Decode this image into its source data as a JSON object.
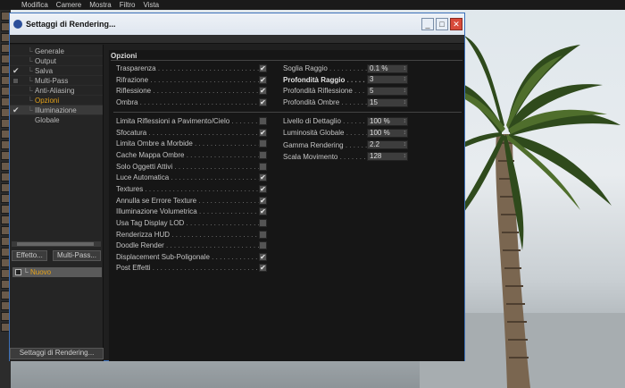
{
  "app_menu": [
    "Modifica",
    "Camere",
    "Mostra",
    "Filtro",
    "Vista"
  ],
  "window": {
    "title": "Settaggi di Rendering...",
    "buttons": {
      "minimize": "_",
      "maximize": "□",
      "close": "✕"
    }
  },
  "sidebar": {
    "items": [
      {
        "label": "Generale",
        "state": "none"
      },
      {
        "label": "Output",
        "state": "none"
      },
      {
        "label": "Salva",
        "state": "checked"
      },
      {
        "label": "Multi-Pass",
        "state": "box"
      },
      {
        "label": "Anti-Aliasing",
        "state": "none"
      },
      {
        "label": "Opzioni",
        "state": "active"
      },
      {
        "label": "Illuminazione Globale",
        "state": "checked"
      }
    ],
    "effect_button": "Effetto...",
    "multipass_button": "Multi-Pass...",
    "new_item": "Nuovo",
    "bottom_button": "Settaggi di Rendering..."
  },
  "options": {
    "title": "Opzioni",
    "top_left": [
      {
        "label": "Trasparenza",
        "checked": true
      },
      {
        "label": "Rifrazione",
        "checked": true
      },
      {
        "label": "Riflessione",
        "checked": true
      },
      {
        "label": "Ombra",
        "checked": true
      }
    ],
    "top_right": [
      {
        "label": "Soglia Raggio",
        "value": "0.1 %",
        "bold": false
      },
      {
        "label": "Profondità Raggio",
        "value": "3",
        "bold": true
      },
      {
        "label": "Profondità Riflessione",
        "value": "5",
        "bold": false
      },
      {
        "label": "Profondità Ombre",
        "value": "15",
        "bold": false
      }
    ],
    "lower_left": [
      {
        "label": "Limita Riflessioni a Pavimento/Cielo",
        "checked": false
      },
      {
        "label": "Sfocatura",
        "checked": true
      },
      {
        "label": "Limita Ombre a Morbide",
        "checked": false
      },
      {
        "label": "Cache Mappa Ombre",
        "checked": false
      },
      {
        "label": "Solo Oggetti Attivi",
        "checked": false
      },
      {
        "label": "Luce Automatica",
        "checked": true
      },
      {
        "label": "Textures",
        "checked": true
      },
      {
        "label": "Annulla se Errore Texture",
        "checked": true
      },
      {
        "label": "Illuminazione Volumetrica",
        "checked": true
      },
      {
        "label": "Usa Tag Display LOD",
        "checked": false
      },
      {
        "label": "Renderizza HUD",
        "checked": false
      },
      {
        "label": "Doodle Render",
        "checked": false
      },
      {
        "label": "Displacement Sub-Poligonale",
        "checked": true
      },
      {
        "label": "Post Effetti",
        "checked": true
      }
    ],
    "lower_right": [
      {
        "label": "Livello di Dettaglio",
        "value": "100 %"
      },
      {
        "label": "Luminosità Globale",
        "value": "100 %"
      },
      {
        "label": "Gamma Rendering",
        "value": "2.2"
      },
      {
        "label": "Scala Movimento",
        "value": "128"
      }
    ]
  },
  "icons": {
    "check": "✔",
    "tree_branch": "└",
    "spinner": "↕"
  }
}
